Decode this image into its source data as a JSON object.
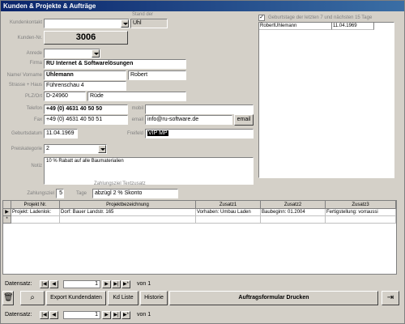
{
  "window": {
    "title": "Kunden & Projekte & Aufträge"
  },
  "header_hint": "Stand der",
  "labels": {
    "kundenkontakt": "Kundenkontakt",
    "kunden_nr": "Kunden-Nr.",
    "anrede": "Anrede",
    "firma": "Firma",
    "name_vorname": "Name/ Vorname",
    "strasse": "Strasse + Haus",
    "plz_ort": "PLZ/Ort",
    "telefon": "Telefon",
    "fax": "Fax",
    "mobil": "mobil",
    "email": "email",
    "geburtsdatum": "Geburtsdatum",
    "freifeld": "Freifeld",
    "preiskategorie": "Preiskategorie",
    "notiz": "Notiz",
    "zahlungsziel": "Zahlungsziel",
    "tage": "Tage",
    "zahlungsziel_textzusatz": "Zahlungsziel Textzusatz"
  },
  "fields": {
    "kundenkontakt": "",
    "uhl": "Uhl",
    "kunden_nr": "3006",
    "anrede": "",
    "firma": "RU Internet & Softwarelösungen",
    "name": "Uhlemann",
    "vorname": "Robert",
    "strasse": "Führenschau 4",
    "plz": "D-24960",
    "ort": "Rüde",
    "telefon": "+49 (0) 4631 40 50 50",
    "fax": "+49 (0) 4631 40 50 51",
    "mobil": "",
    "email": "info@ru-software.de",
    "geburtsdatum": "11.04.1969",
    "freifeld": "VIP MP",
    "preiskategorie": "2",
    "notiz": "10 % Rabatt auf alle Baumaterialien",
    "zahlungsziel": "5",
    "zahlungsziel_text": "abzügl 2 % Skonto"
  },
  "buttons": {
    "email": "email",
    "export": "Export Kundendaten",
    "kd_liste": "Kd Liste",
    "historie": "Historie",
    "drucken": "Auftragsformular Drucken"
  },
  "birthdays": {
    "checkbox_label": "Geburtstage der letzten 7 und nächsten 15 Tage",
    "checked": true,
    "rows": [
      {
        "name": "RobertUhlemann",
        "date": "11.04.1969"
      }
    ]
  },
  "grid": {
    "headers": [
      "Projekt Nr.",
      "Projektbezeichnung",
      "Zusatz1",
      "Zusatz2",
      "Zusatz3"
    ],
    "rows": [
      [
        "Projekt: Ladenlok:",
        "Dorf: Bauer Landstr. 165",
        "Vorhaben: Umbau Laden",
        "Baubeginn: 01.2004",
        "Fertigstellung: vorraussi"
      ]
    ]
  },
  "nav_inner": {
    "label": "Datensatz:",
    "current": "1",
    "total": "von 1"
  },
  "nav_outer": {
    "label": "Datensatz:",
    "current": "1",
    "total": "von 1"
  },
  "icons": {
    "trash": "trash-icon",
    "binoculars": "binoculars-icon",
    "exit": "exit-door-icon"
  }
}
